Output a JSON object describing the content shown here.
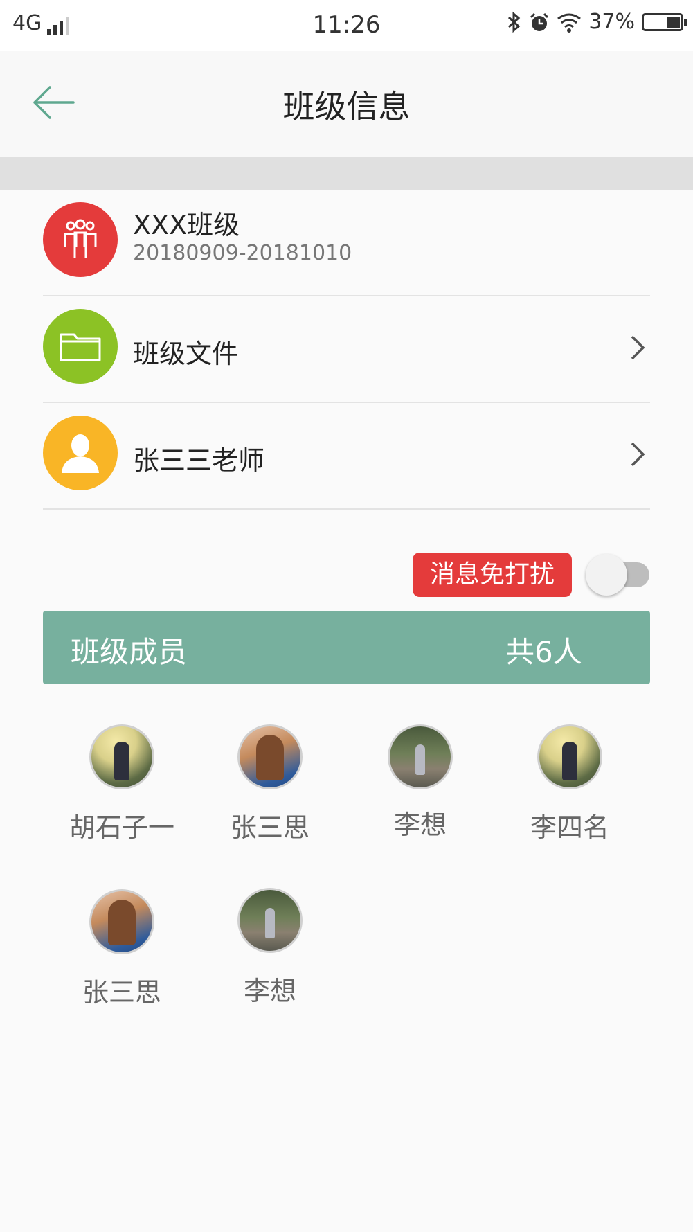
{
  "status_bar": {
    "network": "4G",
    "time": "11:26",
    "battery_percent": "37%",
    "battery_level": 0.37
  },
  "header": {
    "title": "班级信息",
    "back_icon": "arrow-left-icon"
  },
  "class_info": {
    "name": "XXX班级",
    "date_range": "20180909-20181010",
    "icon": "group-icon",
    "icon_color": "#e43b3b"
  },
  "menu": {
    "files_label": "班级文件",
    "files_icon": "folder-icon",
    "files_color": "#8cc225",
    "teacher_label": "张三三老师",
    "teacher_icon": "person-icon",
    "teacher_color": "#f9b526"
  },
  "do_not_disturb": {
    "label": "消息免打扰",
    "enabled": false
  },
  "members": {
    "title": "班级成员",
    "count_text": "共6人",
    "bar_color": "#77b09e",
    "list": [
      {
        "name": "胡石子一"
      },
      {
        "name": "张三思"
      },
      {
        "name": "李想"
      },
      {
        "name": "李四名"
      },
      {
        "name": "张三思"
      },
      {
        "name": "李想"
      }
    ]
  }
}
